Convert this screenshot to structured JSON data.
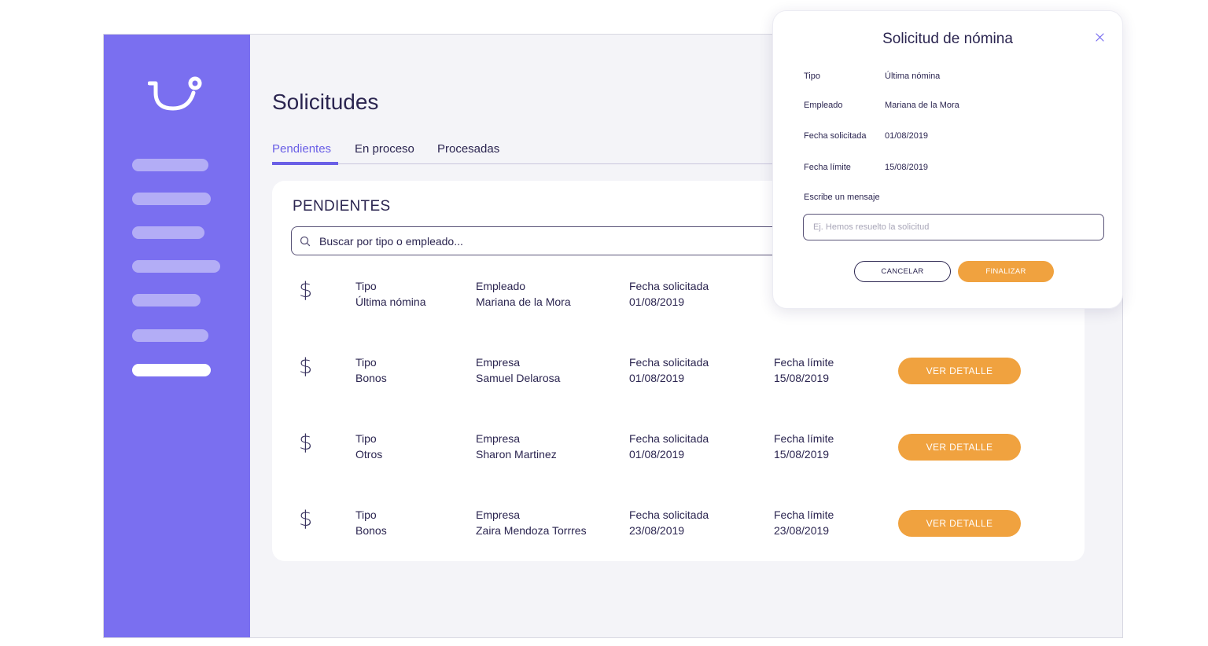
{
  "page": {
    "title": "Solicitudes",
    "tabs": [
      {
        "label": "Pendientes",
        "active": true
      },
      {
        "label": "En proceso",
        "active": false
      },
      {
        "label": "Procesadas",
        "active": false
      }
    ]
  },
  "list": {
    "title": "PENDIENTES",
    "search_placeholder": "Buscar por tipo o empleado...",
    "rows": [
      {
        "icon": "$",
        "type_label": "Tipo",
        "type": "Última nómina",
        "person_label": "Empleado",
        "person": "Mariana de la Mora",
        "requested_label": "Fecha solicitada",
        "requested": "01/08/2019",
        "deadline_label": "",
        "deadline": "",
        "action": ""
      },
      {
        "icon": "$",
        "type_label": "Tipo",
        "type": "Bonos",
        "person_label": "Empresa",
        "person": "Samuel Delarosa",
        "requested_label": "Fecha solicitada",
        "requested": "01/08/2019",
        "deadline_label": "Fecha límite",
        "deadline": "15/08/2019",
        "action": "VER DETALLE"
      },
      {
        "icon": "$",
        "type_label": "Tipo",
        "type": "Otros",
        "person_label": "Empresa",
        "person": "Sharon Martinez",
        "requested_label": "Fecha solicitada",
        "requested": "01/08/2019",
        "deadline_label": "Fecha límite",
        "deadline": "15/08/2019",
        "action": "VER DETALLE"
      },
      {
        "icon": "$",
        "type_label": "Tipo",
        "type": "Bonos",
        "person_label": "Empresa",
        "person": "Zaira Mendoza Torrres",
        "requested_label": "Fecha solicitada",
        "requested": "23/08/2019",
        "deadline_label": "Fecha límite",
        "deadline": "23/08/2019",
        "action": "VER DETALLE"
      }
    ]
  },
  "modal": {
    "title": "Solicitud de nómina",
    "fields": [
      {
        "key": "Tipo",
        "value": "Última nómina"
      },
      {
        "key": "Empleado",
        "value": "Mariana de la Mora"
      },
      {
        "key": "Fecha solicitada",
        "value": "01/08/2019"
      },
      {
        "key": "Fecha límite",
        "value": "15/08/2019"
      }
    ],
    "message_label": "Escribe un mensaje",
    "message_placeholder": "Ej. Hemos resuelto la solicitud",
    "cancel_label": "CANCELAR",
    "finish_label": "FINALIZAR"
  },
  "colors": {
    "sidebar": "#7a6ff0",
    "accent": "#6a5fe6",
    "button": "#f0a23f",
    "text": "#2b2550"
  },
  "icons": [
    "logo-icon",
    "search-icon",
    "dollar-icon",
    "close-icon"
  ]
}
